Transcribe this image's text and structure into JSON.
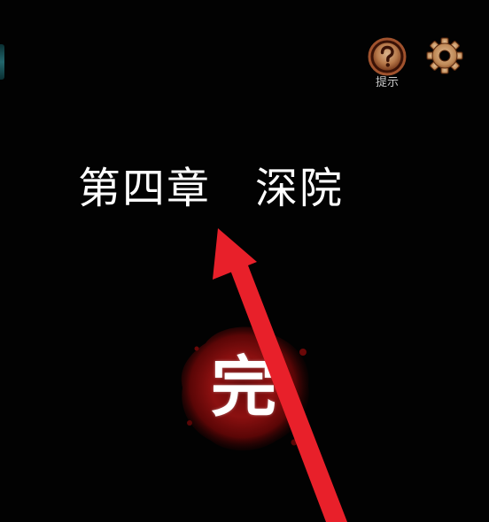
{
  "hud": {
    "hint_label": "提示",
    "hint_icon": "question-icon",
    "settings_icon": "gear-icon"
  },
  "chapter": {
    "number": "第四章",
    "name": "深院"
  },
  "stamp": {
    "text": "完"
  },
  "colors": {
    "background": "#000000",
    "text": "#ffffff",
    "icon_brown": "#a0522d",
    "icon_outer": "#8b3a1f",
    "blood_red": "#8b0c0c",
    "arrow_red": "#e8202a"
  }
}
